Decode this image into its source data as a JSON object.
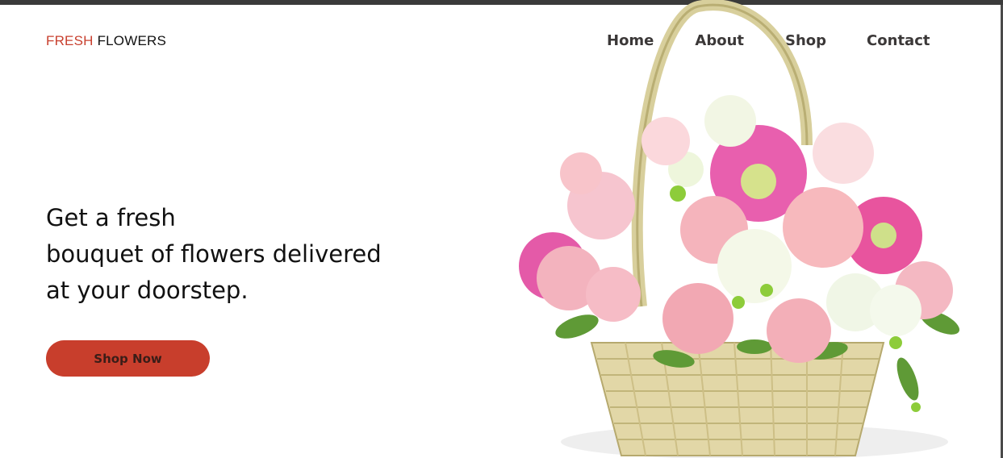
{
  "header": {
    "logo": {
      "part1": "FRESH",
      "part2": "FLOWERS"
    },
    "nav": [
      "Home",
      "About",
      "Shop",
      "Contact"
    ]
  },
  "hero": {
    "line1": "Get a fresh",
    "line2": "bouquet of flowers delivered",
    "line3": "at your doorstep.",
    "cta_label": "Shop Now"
  },
  "colors": {
    "brand": "#c8402f",
    "button": "#c83e2c",
    "nav_text": "#3b3838"
  },
  "image": {
    "icon": "flower-basket-image"
  }
}
